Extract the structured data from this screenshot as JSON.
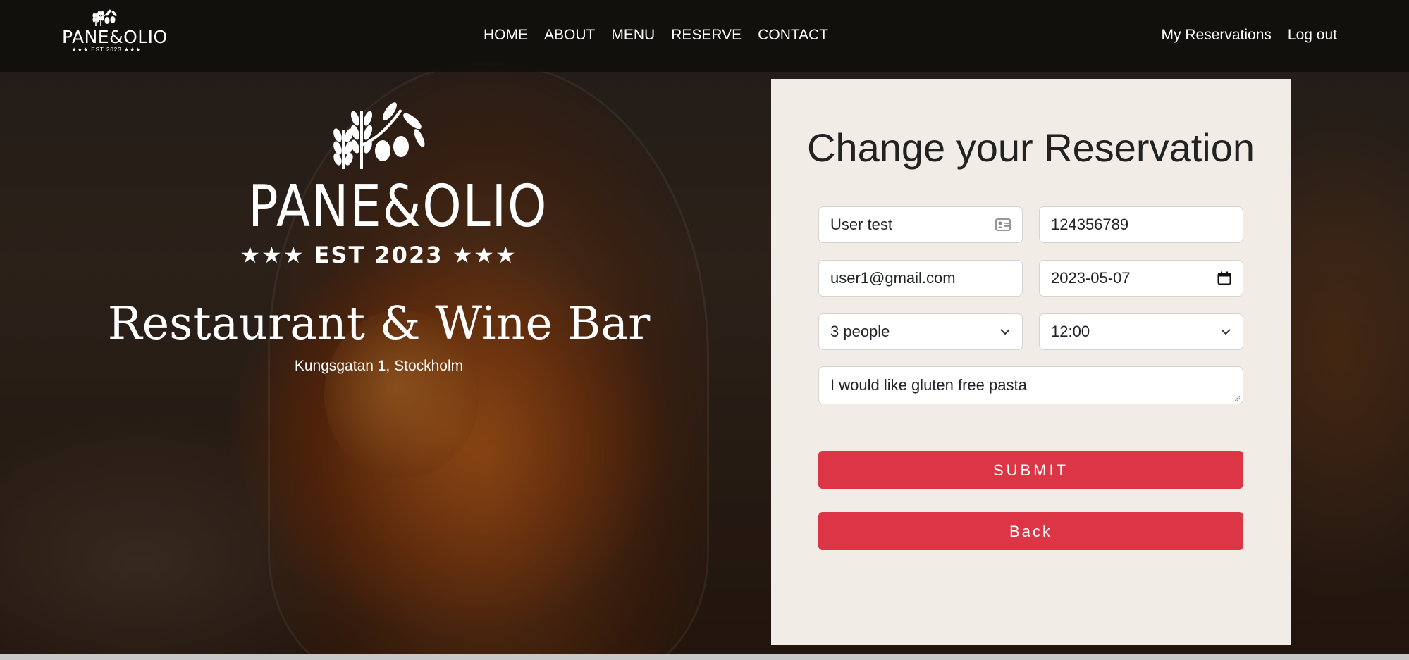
{
  "brand": {
    "name": "PANE&OLIO",
    "est": "★★★ EST 2023 ★★★"
  },
  "nav": {
    "items": [
      "HOME",
      "ABOUT",
      "MENU",
      "RESERVE",
      "CONTACT"
    ],
    "right": [
      "My Reservations",
      "Log out"
    ]
  },
  "hero": {
    "title": "Restaurant & Wine Bar",
    "address": "Kungsgatan 1, Stockholm"
  },
  "form": {
    "title": "Change your Reservation",
    "name": "User test",
    "phone": "124356789",
    "email": "user1@gmail.com",
    "date": "2023-05-07",
    "guests": "3 people",
    "time": "12:00",
    "message": "I would like gluten free pasta",
    "submit_label": "SUBMIT",
    "back_label": "Back"
  },
  "icons": {
    "name_field": "contact-card-icon",
    "date_field": "calendar-icon",
    "select": "chevron-down-icon",
    "logo": "wheat-olive-branch-icon"
  },
  "colors": {
    "accent": "#dc3545",
    "panel": "#f1ede6",
    "header": "#110f0d"
  }
}
